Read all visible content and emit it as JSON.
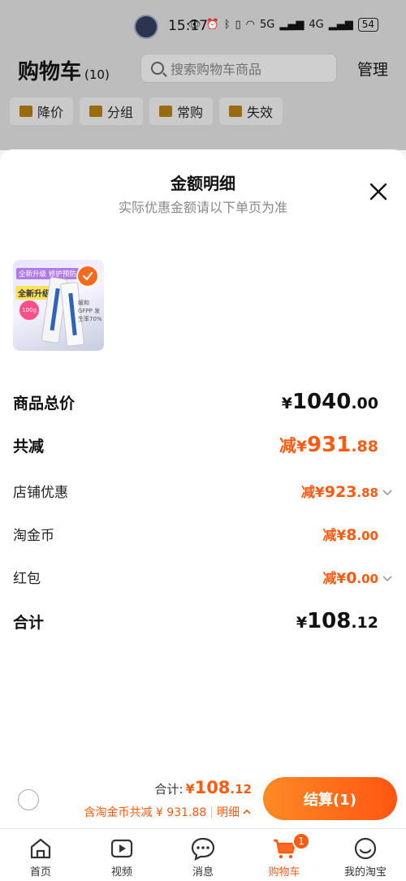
{
  "status_bar": {
    "time": "15:17",
    "battery": "54",
    "network_1": "5G",
    "network_2": "4G"
  },
  "cart_header": {
    "title": "购物车",
    "count": "(10)",
    "search_placeholder": "搜索购物车商品",
    "manage_label": "管理"
  },
  "filters": [
    {
      "label": "降价",
      "icon": "price-drop-icon"
    },
    {
      "label": "分组",
      "icon": "folder-icon"
    },
    {
      "label": "常购",
      "icon": "cart-icon"
    },
    {
      "label": "失效",
      "icon": "invalid-icon"
    }
  ],
  "sheet": {
    "title": "金额明细",
    "subtitle": "实际优惠金额请以下单页为准",
    "product_image": {
      "banner": "全新升级 修护预防",
      "tag": "全新升级",
      "badge": "100g",
      "note": "缓和GFPP 发生率70%"
    },
    "rows": [
      {
        "label": "商品总价",
        "prefix": "",
        "currency": "¥",
        "integer": "1040",
        "decimal": ".00"
      },
      {
        "label": "共减",
        "prefix": "减",
        "currency": "¥",
        "integer": "931",
        "decimal": ".88"
      },
      {
        "label": "店铺优惠",
        "prefix": "减",
        "currency": "¥",
        "integer": "923",
        "decimal": ".88"
      },
      {
        "label": "淘金币",
        "prefix": "减",
        "currency": "¥",
        "integer": "8",
        "decimal": ".00"
      },
      {
        "label": "红包",
        "prefix": "减",
        "currency": "¥",
        "integer": "0",
        "decimal": ".00"
      },
      {
        "label": "合计",
        "prefix": "",
        "currency": "¥",
        "integer": "108",
        "decimal": ".12"
      }
    ]
  },
  "checkout": {
    "total_label": "合计:",
    "total_currency": "¥",
    "total_integer": "108",
    "total_decimal": ".12",
    "discount_text": "含淘金币共减 ¥ 931.88",
    "separator": "|",
    "detail_label": "明细",
    "button_label": "结算(1)"
  },
  "tabs": [
    {
      "label": "首页",
      "icon": "home-icon"
    },
    {
      "label": "视频",
      "icon": "video-icon"
    },
    {
      "label": "消息",
      "icon": "message-icon"
    },
    {
      "label": "购物车",
      "icon": "cart-icon",
      "badge": "1",
      "active": true
    },
    {
      "label": "我的淘宝",
      "icon": "profile-icon"
    }
  ],
  "colors": {
    "accent": "#ff5a12",
    "overlay": "#bdbdbd",
    "text": "#111111"
  }
}
